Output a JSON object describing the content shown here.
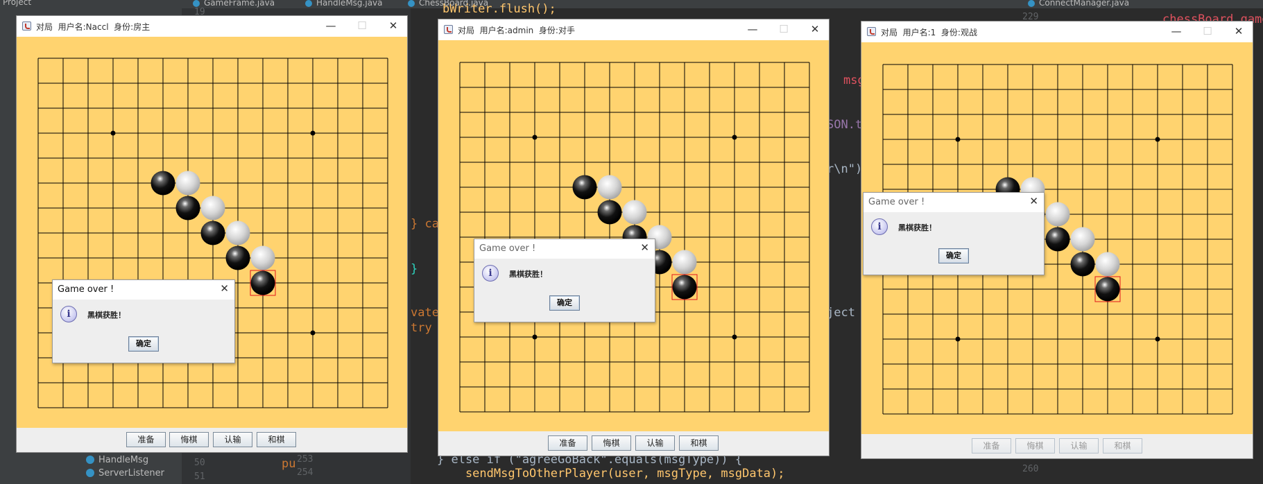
{
  "ide": {
    "project_label": "Project",
    "tabs": [
      "GameFrame.java",
      "HandleMsg.java",
      "ChessBoard.java",
      "ConnectManager.java"
    ],
    "tree_items": [
      "HandleMsg",
      "ServerListener"
    ],
    "line_numbers": [
      "50",
      "51",
      "253",
      "254",
      "229",
      "260",
      "19"
    ],
    "code_fragments": {
      "catch": "} ca",
      "brace": "}",
      "private": "vate",
      "try": "try",
      "else_if": "} else if (\"agreeGoBack\".equals(msgType)) {",
      "send": "    sendMsgToOtherPlayer(user, msgType, msgData);",
      "pu": "pu",
      "flush": "bWriter.flush();",
      "right_call": "chessBoard.game",
      "json_frag": "SON.t",
      "n_frag": "r\\n\");",
      "msg_frag": "msg",
      "object_frag": "ject"
    }
  },
  "windows": [
    {
      "title": "对局  用户名:Naccl  身份:房主",
      "buttons": [
        "准备",
        "悔棋",
        "认输",
        "和棋"
      ],
      "buttons_enabled": true,
      "dialog": {
        "title": "Game over !",
        "message": "黑棋获胜！",
        "ok": "确定"
      }
    },
    {
      "title": "对局  用户名:admin  身份:对手",
      "buttons": [
        "准备",
        "悔棋",
        "认输",
        "和棋"
      ],
      "buttons_enabled": true,
      "dialog": {
        "title": "Game over !",
        "message": "黑棋获胜！",
        "ok": "确定"
      }
    },
    {
      "title": "对局  用户名:1  身份:观战",
      "buttons": [
        "准备",
        "悔棋",
        "认输",
        "和棋"
      ],
      "buttons_enabled": false,
      "dialog": {
        "title": "Game over !",
        "message": "黑棋获胜！",
        "ok": "确定"
      }
    }
  ],
  "window_controls": {
    "minimize": "—",
    "maximize": "☐",
    "close": "✕"
  },
  "board": {
    "size": 15,
    "star_points": [
      [
        3,
        3
      ],
      [
        11,
        3
      ],
      [
        3,
        11
      ],
      [
        11,
        11
      ]
    ],
    "stones": [
      {
        "col": 5,
        "row": 5,
        "color": "black"
      },
      {
        "col": 6,
        "row": 5,
        "color": "white"
      },
      {
        "col": 6,
        "row": 6,
        "color": "black"
      },
      {
        "col": 7,
        "row": 6,
        "color": "white"
      },
      {
        "col": 7,
        "row": 7,
        "color": "black"
      },
      {
        "col": 8,
        "row": 7,
        "color": "white"
      },
      {
        "col": 8,
        "row": 8,
        "color": "black"
      },
      {
        "col": 9,
        "row": 8,
        "color": "white"
      },
      {
        "col": 9,
        "row": 9,
        "color": "black"
      }
    ],
    "last_move": {
      "col": 9,
      "row": 9
    }
  },
  "colors": {
    "board_bg": "#ffd36f",
    "last_move_marker": "#e0161b",
    "ide_bg": "#2b2b2b"
  }
}
